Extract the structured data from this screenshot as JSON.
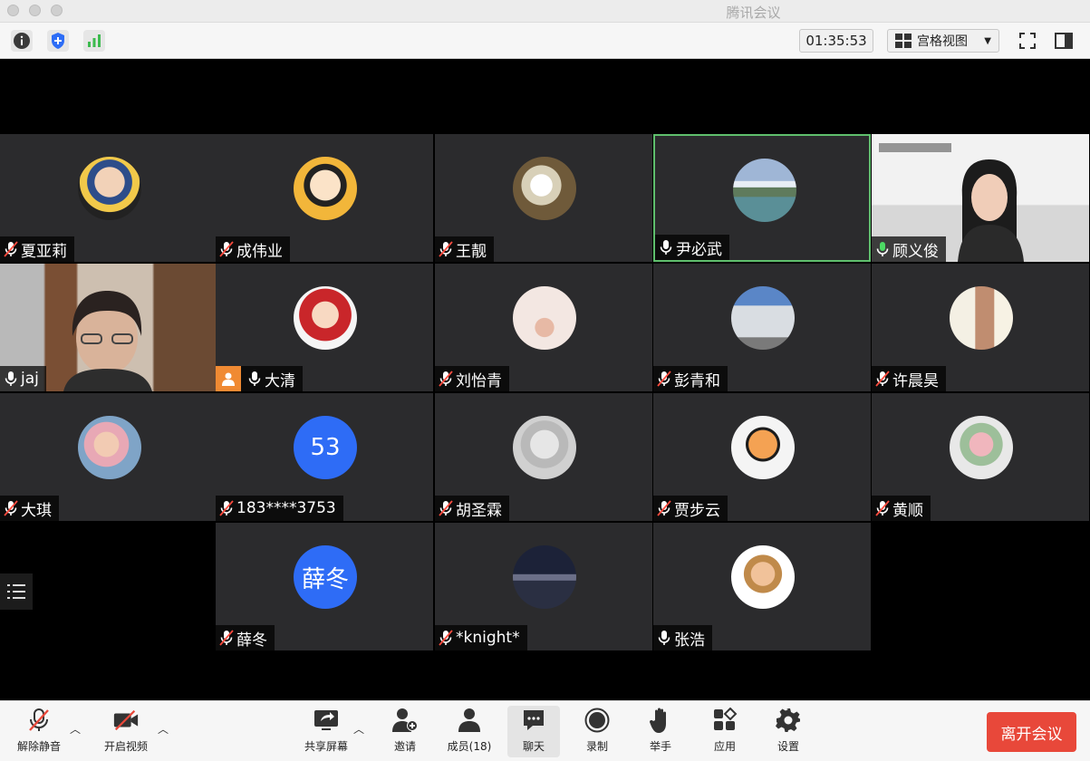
{
  "window": {
    "title": "腾讯会议"
  },
  "top_toolbar": {
    "timer": "01:35:53",
    "view_mode": "宫格视图",
    "icons": [
      "info-icon",
      "shield-plus-icon",
      "signal-bars-icon",
      "fullscreen-icon",
      "side-panel-icon"
    ]
  },
  "participants": [
    {
      "name": "夏亚莉",
      "mic": "muted",
      "avatar": "photo"
    },
    {
      "name": "成伟业",
      "mic": "muted",
      "avatar": "photo"
    },
    {
      "name": "王靓",
      "mic": "muted",
      "avatar": "photo"
    },
    {
      "name": "尹必武",
      "mic": "on",
      "avatar": "photo",
      "speaking": true
    },
    {
      "name": "顾义俊",
      "mic": "active",
      "avatar": "video"
    },
    {
      "name": "jaj",
      "mic": "on",
      "avatar": "video"
    },
    {
      "name": "大清",
      "mic": "on",
      "avatar": "photo",
      "host": true
    },
    {
      "name": "刘怡青",
      "mic": "muted",
      "avatar": "photo"
    },
    {
      "name": "彭青和",
      "mic": "muted",
      "avatar": "photo"
    },
    {
      "name": "许晨昊",
      "mic": "muted",
      "avatar": "photo"
    },
    {
      "name": "大琪",
      "mic": "muted",
      "avatar": "photo"
    },
    {
      "name": "183****3753",
      "mic": "muted",
      "avatar": "initials",
      "initials": "53"
    },
    {
      "name": "胡圣霖",
      "mic": "muted",
      "avatar": "photo"
    },
    {
      "name": "贾步云",
      "mic": "muted",
      "avatar": "photo"
    },
    {
      "name": "黄顺",
      "mic": "muted",
      "avatar": "photo"
    },
    {
      "name": "薛冬",
      "mic": "muted",
      "avatar": "initials",
      "initials": "薛冬"
    },
    {
      "name": "*knight*",
      "mic": "muted",
      "avatar": "photo"
    },
    {
      "name": "张浩",
      "mic": "on",
      "avatar": "photo"
    }
  ],
  "bottom_toolbar": {
    "unmute": "解除静音",
    "start_video": "开启视频",
    "share_screen": "共享屏幕",
    "invite": "邀请",
    "members": "成员(18)",
    "chat": "聊天",
    "record": "录制",
    "raise_hand": "举手",
    "apps": "应用",
    "settings": "设置",
    "leave": "离开会议"
  },
  "colors": {
    "leave_button": "#e8483a",
    "active_speaker_border": "#5fbf6d",
    "initials_avatar": "#2e6cf6",
    "host_badge": "#f08a33"
  }
}
